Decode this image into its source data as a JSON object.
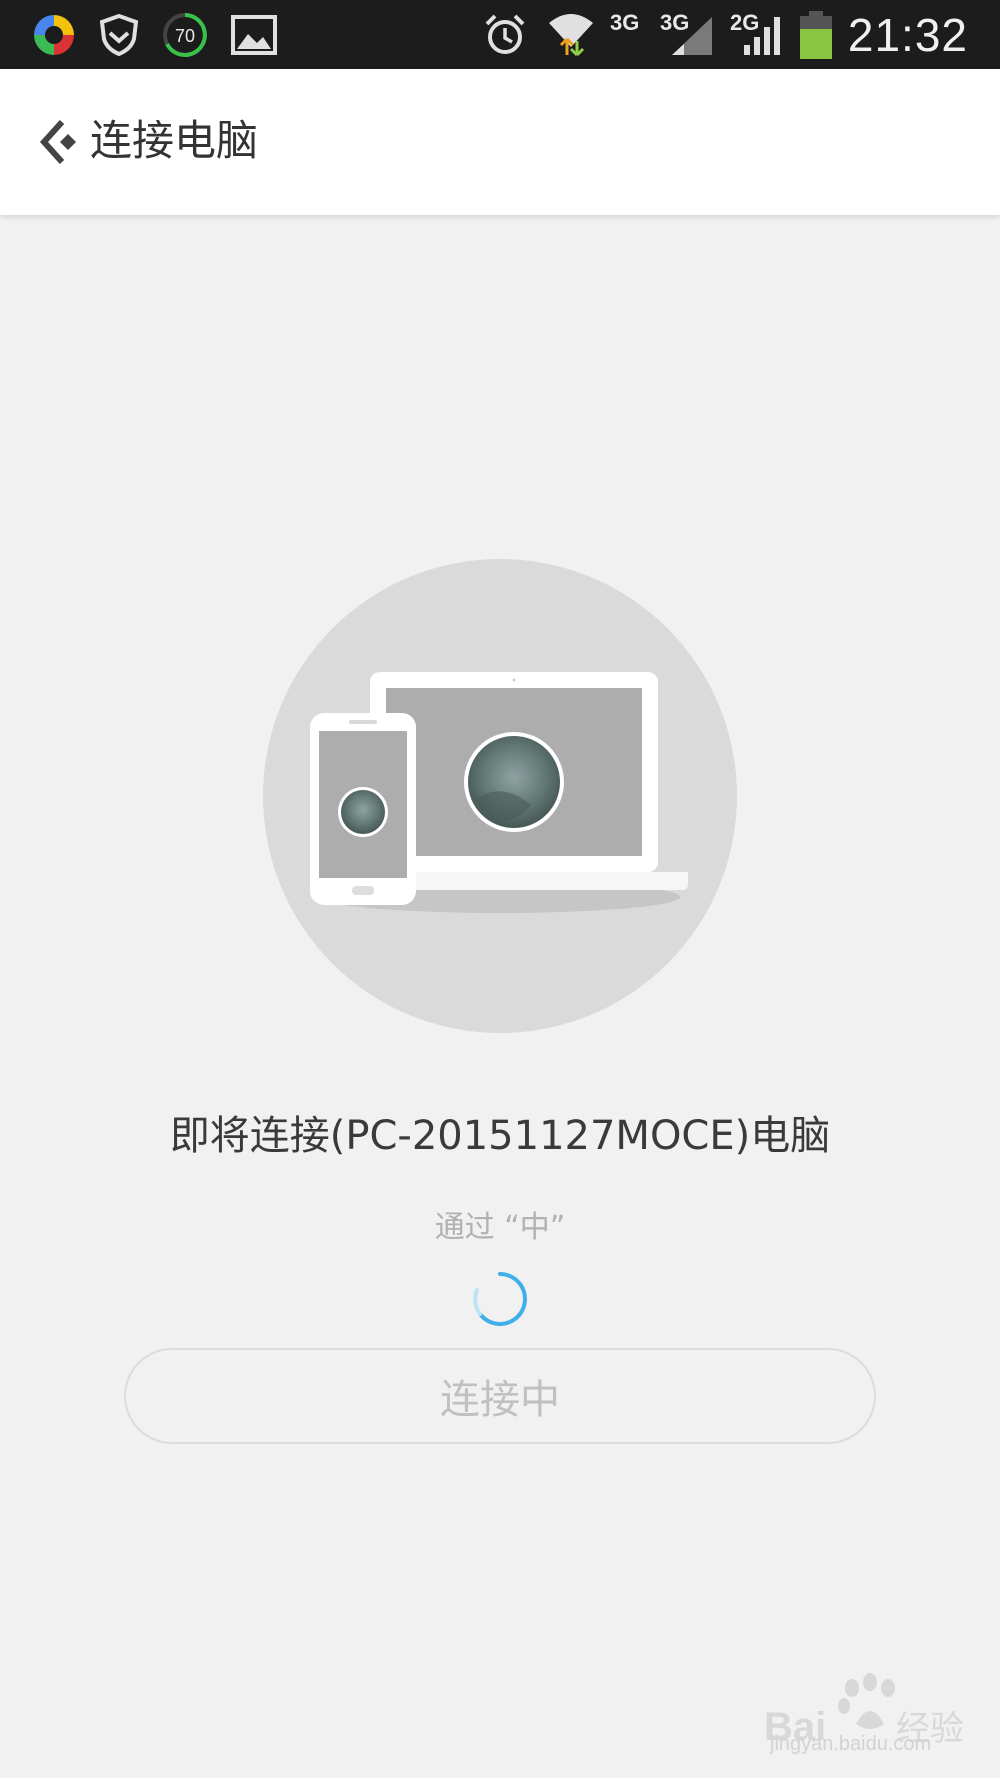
{
  "status_bar": {
    "time": "21:32",
    "battery_badge": "70",
    "net_labels": [
      "3G",
      "3G",
      "2G"
    ],
    "icons": [
      "browser-ball-icon",
      "shield-icon",
      "battery-saver-icon",
      "gallery-icon",
      "alarm-icon",
      "wifi-icon",
      "signal-icon",
      "signal-icon",
      "signal-icon",
      "battery-icon"
    ]
  },
  "header": {
    "title": "连接电脑",
    "back_icon": "back-arrow-icon"
  },
  "main": {
    "message": "即将连接(PC-20151127MOCE)电脑",
    "via": "通过 “中”",
    "button_label": "连接中",
    "illustration": "phone-and-laptop-icon"
  },
  "watermark": {
    "url": "jingyan.baidu.com",
    "logo": "baidu-jingyan-logo"
  },
  "colors": {
    "status_bar_bg": "#1c1c1c",
    "page_bg": "#f1f1f1",
    "spinner": "#2aa7e8",
    "battery": "#8bc53f",
    "text_primary": "#3a3a3a",
    "text_muted": "#b1b1b1"
  }
}
